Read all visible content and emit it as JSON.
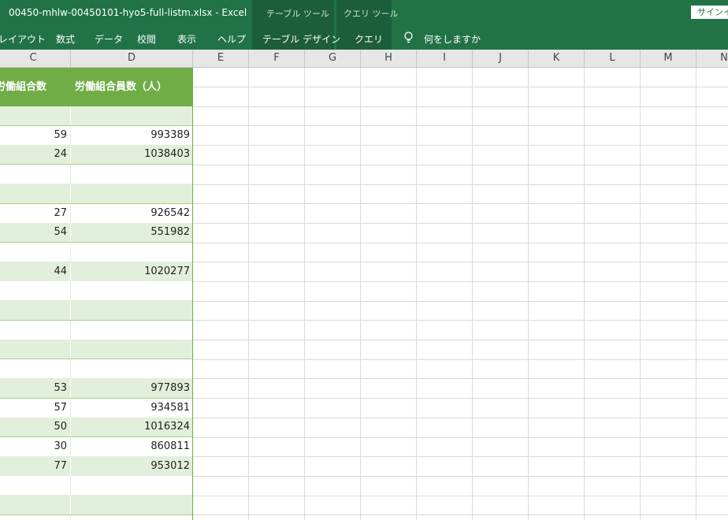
{
  "window": {
    "doc_title": "00450-mhlw-00450101-hyo5-full-listm.xlsx  -  Excel",
    "context_table_tools": "テーブル ツール",
    "context_query_tools": "クエリ ツール",
    "signin_label": "サインイン"
  },
  "ribbon_tabs": {
    "layout": "レイアウト",
    "formulas": "数式",
    "data": "データ",
    "review": "校閲",
    "view": "表示",
    "help": "ヘルプ",
    "table_design": "テーブル デザイン",
    "query": "クエリ",
    "tell_me": "何をしますか",
    "tell_me_icon": "lightbulb-icon"
  },
  "columns": [
    "C",
    "D",
    "E",
    "F",
    "G",
    "H",
    "I",
    "J",
    "K",
    "L",
    "M",
    "N"
  ],
  "table": {
    "header_c": "労働組合数",
    "header_d": "労働組合員数（人）",
    "rows": [
      {
        "c": "",
        "d": ""
      },
      {
        "c": "59",
        "d": "993389"
      },
      {
        "c": "24",
        "d": "1038403"
      },
      {
        "c": "",
        "d": ""
      },
      {
        "c": "",
        "d": ""
      },
      {
        "c": "27",
        "d": "926542"
      },
      {
        "c": "54",
        "d": "551982"
      },
      {
        "c": "",
        "d": ""
      },
      {
        "c": "44",
        "d": "1020277"
      },
      {
        "c": "",
        "d": ""
      },
      {
        "c": "",
        "d": ""
      },
      {
        "c": "",
        "d": ""
      },
      {
        "c": "",
        "d": ""
      },
      {
        "c": "",
        "d": ""
      },
      {
        "c": "53",
        "d": "977893"
      },
      {
        "c": "57",
        "d": "934581"
      },
      {
        "c": "50",
        "d": "1016324"
      },
      {
        "c": "30",
        "d": "860811"
      },
      {
        "c": "77",
        "d": "953012"
      },
      {
        "c": "",
        "d": ""
      },
      {
        "c": "",
        "d": ""
      },
      {
        "c": "",
        "d": ""
      }
    ]
  },
  "colors": {
    "ribbon": "#217346",
    "table_header": "#70ad47",
    "band_row": "#e2efda"
  }
}
